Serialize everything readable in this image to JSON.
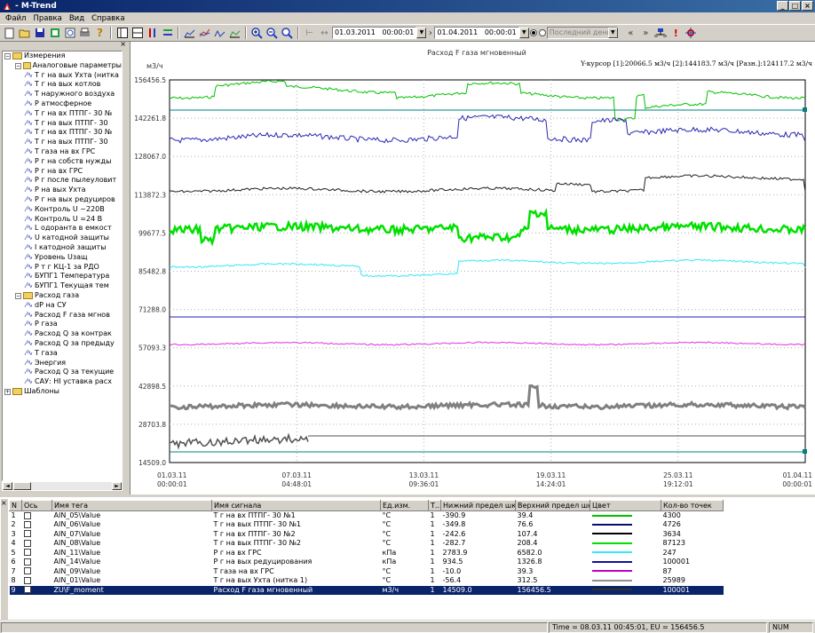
{
  "window": {
    "title": "- M-Trend"
  },
  "menu": [
    "Файл",
    "Правка",
    "Вид",
    "Справка"
  ],
  "toolbar": {
    "date_from": "01.03.2011",
    "time_from": "00:00:01",
    "date_to": "01.04.2011",
    "time_to": "00:00:01",
    "period_placeholder": "Последний день"
  },
  "tree": [
    {
      "level": 0,
      "kind": "folder",
      "label": "Измерения",
      "pm": "−"
    },
    {
      "level": 1,
      "kind": "folder",
      "label": "Аналоговые параметры",
      "pm": "−"
    },
    {
      "level": 2,
      "kind": "sig",
      "label": "T г на вых Ухта (нитка"
    },
    {
      "level": 2,
      "kind": "sig",
      "label": "T г на вых котлов"
    },
    {
      "level": 2,
      "kind": "sig",
      "label": "T наружного воздуха"
    },
    {
      "level": 2,
      "kind": "sig",
      "label": "P атмосферное"
    },
    {
      "level": 2,
      "kind": "sig",
      "label": "T г на вх ПТПГ- 30 №"
    },
    {
      "level": 2,
      "kind": "sig",
      "label": "T г на вых ПТПГ- 30"
    },
    {
      "level": 2,
      "kind": "sig",
      "label": "T г на вх ПТПГ- 30 №"
    },
    {
      "level": 2,
      "kind": "sig",
      "label": "T г на вых ПТПГ- 30"
    },
    {
      "level": 2,
      "kind": "sig",
      "label": "T газа на вх ГРС"
    },
    {
      "level": 2,
      "kind": "sig",
      "label": "P г на собств нужды"
    },
    {
      "level": 2,
      "kind": "sig",
      "label": "P г на вх ГРС"
    },
    {
      "level": 2,
      "kind": "sig",
      "label": "P г после пылеуловит"
    },
    {
      "level": 2,
      "kind": "sig",
      "label": "P на вых Ухта"
    },
    {
      "level": 2,
      "kind": "sig",
      "label": "P г на вых редуциров"
    },
    {
      "level": 2,
      "kind": "sig",
      "label": "Контроль U ~220В"
    },
    {
      "level": 2,
      "kind": "sig",
      "label": "Контроль U =24 В"
    },
    {
      "level": 2,
      "kind": "sig",
      "label": "L одоранта в емкост"
    },
    {
      "level": 2,
      "kind": "sig",
      "label": "U катодной защиты"
    },
    {
      "level": 2,
      "kind": "sig",
      "label": "I катодной защиты"
    },
    {
      "level": 2,
      "kind": "sig",
      "label": "Уровень Uзащ"
    },
    {
      "level": 2,
      "kind": "sig",
      "label": "P т г  КЦ-1 за РДО"
    },
    {
      "level": 2,
      "kind": "sig",
      "label": "БУПГ1 Температура"
    },
    {
      "level": 2,
      "kind": "sig",
      "label": "БУПГ1 Текущая тем"
    },
    {
      "level": 1,
      "kind": "folder",
      "label": "Расход газа",
      "pm": "−"
    },
    {
      "level": 2,
      "kind": "sig",
      "label": "dP на СУ"
    },
    {
      "level": 2,
      "kind": "sig",
      "label": "Расход F газа мгнов"
    },
    {
      "level": 2,
      "kind": "sig",
      "label": "P газа"
    },
    {
      "level": 2,
      "kind": "sig",
      "label": "Расход Q за контрак"
    },
    {
      "level": 2,
      "kind": "sig",
      "label": "Расход Q за предыду"
    },
    {
      "level": 2,
      "kind": "sig",
      "label": "T газа"
    },
    {
      "level": 2,
      "kind": "sig",
      "label": "Энергия"
    },
    {
      "level": 2,
      "kind": "sig",
      "label": "Расход Q за текущие"
    },
    {
      "level": 2,
      "kind": "sig",
      "label": "САУ: НI уставка расх"
    },
    {
      "level": 0,
      "kind": "folder",
      "label": "Шаблоны",
      "pm": "+"
    }
  ],
  "chart": {
    "title": "Расход F газа мгновенный",
    "unit": "м3/ч",
    "cursor_info": "Y-курсор [1]:20066.5 м3/ч [2]:144183.7 м3/ч [Разн.]:124117.2 м3/ч",
    "y_ticks": [
      "156456.5",
      "142261.8",
      "128067.0",
      "113872.3",
      "99677.5",
      "85482.8",
      "71288.0",
      "57093.3",
      "42898.5",
      "28703.8",
      "14509.0"
    ],
    "x_ticks": [
      [
        "01.03.11",
        "00:00:01"
      ],
      [
        "07.03.11",
        "04:48:01"
      ],
      [
        "13.03.11",
        "09:36:01"
      ],
      [
        "19.03.11",
        "14:24:01"
      ],
      [
        "25.03.11",
        "19:12:01"
      ],
      [
        "01.04.11",
        "00:00:01"
      ]
    ]
  },
  "chart_data": {
    "type": "line",
    "title": "Расход F газа мгновенный",
    "ylabel": "м3/ч",
    "ylim": [
      14509.0,
      156456.5
    ],
    "x_start": "01.03.11 00:00:01",
    "x_end": "01.04.11 00:00:01",
    "series": [
      {
        "name": "T г на вх ПТПГ- 30 №1",
        "color": "#00c000"
      },
      {
        "name": "T г на вых ПТПГ- 30 №1",
        "color": "#2828b0"
      },
      {
        "name": "T г на вх ПТПГ- 30 №2",
        "color": "#202020"
      },
      {
        "name": "T г на вых ПТПГ- 30 №2",
        "color": "#00e000"
      },
      {
        "name": "P г на вх ГРС",
        "color": "#30e8f8"
      },
      {
        "name": "P г на вых редуцирования",
        "color": "#2020c0"
      },
      {
        "name": "T газа на вх ГРС",
        "color": "#e030e0"
      },
      {
        "name": "T г на вых Ухта (нитка 1)",
        "color": "#808080"
      },
      {
        "name": "Расход F газа мгновенный",
        "color": "#505050"
      }
    ],
    "cursor_values": [
      20066.5,
      144183.7
    ]
  },
  "table": {
    "headers": [
      "N",
      "Ось",
      "Имя тега",
      "Имя сигнала",
      "Ед.изм.",
      "Т...",
      "Нижний предел шк...",
      "Верхний предел шк...",
      "Цвет",
      "Кол-во точек"
    ],
    "rows": [
      [
        "1",
        "",
        "AIN_05\\Value",
        "T г на вх ПТПГ- 30 №1",
        "°С",
        "1",
        "-390.9",
        "39.4",
        "#00c000",
        "4300"
      ],
      [
        "2",
        "",
        "AIN_06\\Value",
        "T г на вых ПТПГ- 30 №1",
        "°С",
        "1",
        "-349.8",
        "76.6",
        "#0a0a70",
        "4726"
      ],
      [
        "3",
        "",
        "AIN_07\\Value",
        "T г на вх ПТПГ- 30 №2",
        "°С",
        "1",
        "-242.6",
        "107.4",
        "#000000",
        "3634"
      ],
      [
        "4",
        "",
        "AIN_08\\Value",
        "T г на вых ПТПГ- 30 №2",
        "°С",
        "1",
        "-282.7",
        "208.4",
        "#00e000",
        "87123"
      ],
      [
        "5",
        "",
        "AIN_11\\Value",
        "P г на вх ГРС",
        "кПа",
        "1",
        "2783.9",
        "6582.0",
        "#30e8f8",
        "247"
      ],
      [
        "6",
        "",
        "AIN_14\\Value",
        "P г на вых редуцирования",
        "кПа",
        "1",
        "934.5",
        "1326.8",
        "#1010a0",
        "100001"
      ],
      [
        "7",
        "",
        "AIN_09\\Value",
        "T газа на вх ГРС",
        "°С",
        "1",
        "-10.0",
        "39.3",
        "#c000c0",
        "87"
      ],
      [
        "8",
        "",
        "AIN_01\\Value",
        "T г на вых Ухта (нитка 1)",
        "°С",
        "1",
        "-56.4",
        "312.5",
        "#909090",
        "25989"
      ],
      [
        "9",
        "",
        "ZU\\F_moment",
        "Расход F газа мгновенный",
        "м3/ч",
        "1",
        "14509.0",
        "156456.5",
        "#303030",
        "100001"
      ]
    ]
  },
  "status": {
    "cursor": "Time = 08.03.11 00:45:01, EU = 156456.5",
    "num": "NUM"
  }
}
